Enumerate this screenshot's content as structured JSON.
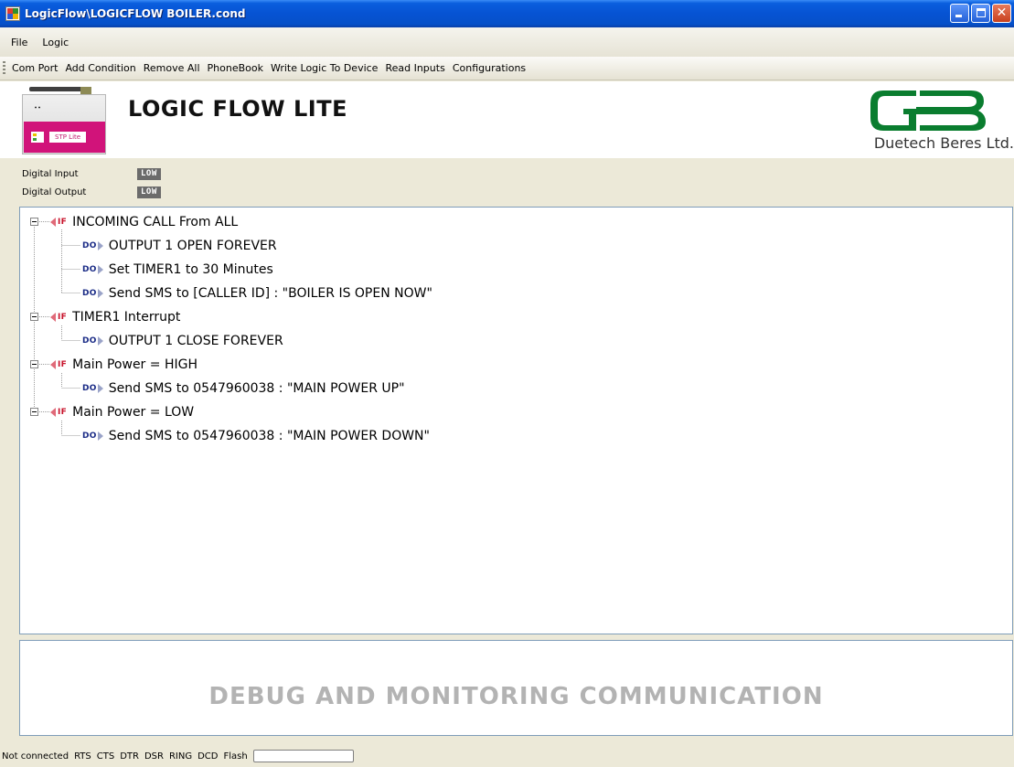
{
  "window": {
    "title": "LogicFlow\\LOGICFLOW BOILER.cond"
  },
  "menu": {
    "items": [
      "File",
      "Logic"
    ]
  },
  "toolbar": {
    "items": [
      "Com Port",
      "Add Condition",
      "Remove All",
      "PhoneBook",
      "Write Logic To Device",
      "Read Inputs",
      "Configurations"
    ]
  },
  "header": {
    "product_name": "LOGIC FLOW LITE",
    "device_label": "STP Lite",
    "company": "Duetech Beres Ltd.",
    "colors": {
      "logo_green": "#0a7d2f",
      "device_panel": "#d1137a"
    }
  },
  "io": {
    "digital_input": {
      "label": "Digital Input",
      "value": "LOW"
    },
    "digital_output": {
      "label": "Digital Output",
      "value": "LOW"
    }
  },
  "tree": {
    "if_tag": "IF",
    "do_tag": "DO",
    "conditions": [
      {
        "text": "INCOMING CALL From ALL",
        "actions": [
          "OUTPUT 1 OPEN FOREVER",
          "Set TIMER1 to 30 Minutes",
          "Send SMS to [CALLER ID] : \"BOILER IS OPEN NOW\""
        ]
      },
      {
        "text": "TIMER1 Interrupt",
        "actions": [
          "OUTPUT 1 CLOSE FOREVER"
        ]
      },
      {
        "text": "Main Power  =  HIGH",
        "actions": [
          "Send SMS to 0547960038 : \"MAIN POWER UP\""
        ]
      },
      {
        "text": "Main Power  =  LOW",
        "actions": [
          "Send SMS to 0547960038 : \"MAIN POWER DOWN\""
        ]
      }
    ]
  },
  "debug": {
    "title": "DEBUG AND MONITORING COMMUNICATION"
  },
  "status": {
    "items": [
      "Not connected",
      "RTS",
      "CTS",
      "DTR",
      "DSR",
      "RING",
      "DCD",
      "Flash"
    ]
  }
}
